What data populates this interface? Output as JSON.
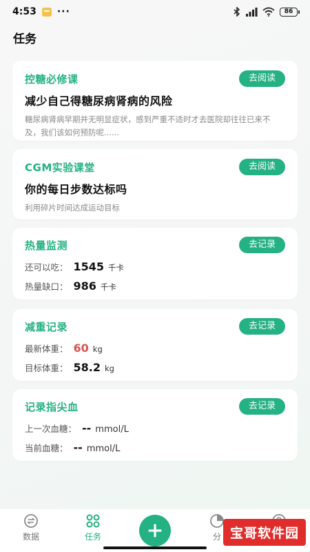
{
  "status_bar": {
    "time": "4:53",
    "battery": "86"
  },
  "header": {
    "title": "任务"
  },
  "cards": [
    {
      "title": "控糖必修课",
      "action": "去阅读",
      "heading": "减少自己得糖尿病肾病的风险",
      "desc": "糖尿病肾病早期并无明显症状，感到严重不适时才去医院却往往已来不及，我们该如何预防呢......"
    },
    {
      "title": "CGM实验课堂",
      "action": "去阅读",
      "heading": "你的每日步数达标吗",
      "desc": "利用碎片时间达成运动目标"
    },
    {
      "title": "热量监测",
      "action": "去记录",
      "rows": [
        {
          "label": "还可以吃：",
          "value": "1545",
          "unit": "千卡"
        },
        {
          "label": "热量缺口：",
          "value": "986",
          "unit": "千卡"
        }
      ]
    },
    {
      "title": "减重记录",
      "action": "去记录",
      "rows": [
        {
          "label": "最新体重：",
          "value": "60",
          "unit": "kg"
        },
        {
          "label": "目标体重：",
          "value": "58.2",
          "unit": "kg"
        }
      ]
    },
    {
      "title": "记录指尖血",
      "action": "去记录",
      "rows": [
        {
          "label": "上一次血糖：",
          "value": "--",
          "unit": "mmol/L"
        },
        {
          "label": "当前血糖：",
          "value": "--",
          "unit": "mmol/L"
        }
      ]
    }
  ],
  "nav": {
    "items": [
      {
        "label": "数据",
        "icon": "data-icon"
      },
      {
        "label": "任务",
        "icon": "task-icon"
      },
      {
        "label": "",
        "icon": "plus-icon"
      },
      {
        "label": "分",
        "icon": "share-icon"
      },
      {
        "label": "",
        "icon": "profile-icon"
      }
    ]
  },
  "watermark": "宝哥软件园",
  "colors": {
    "accent": "#24b183",
    "weight_value": "#d9534f"
  }
}
